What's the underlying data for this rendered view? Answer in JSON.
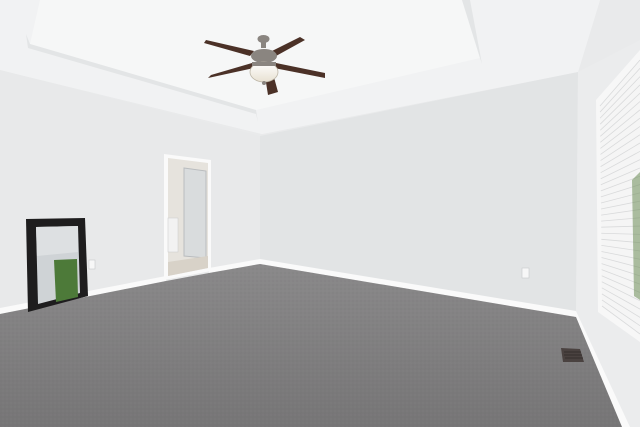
{
  "colors": {
    "ceiling": "#f1f2f3",
    "tray_ceiling": "#f6f7f7",
    "tray_side": "#e3e5e6",
    "left_wall": "#e8e9ea",
    "back_wall": "#e2e4e5",
    "right_wall": "#ebeced",
    "baseboard": "#fafafa",
    "carpet": "#7c7b7c",
    "carpet_dark": "#6e6d6e",
    "fan_blade": "#4b3127",
    "fan_metal": "#8a8580",
    "fan_light": "#f3efe6",
    "mirror_frame": "#1e1d1e",
    "mirror_glass": "#cfd3d6",
    "mirror_greenery": "#4d7a39",
    "blinds": "#f5f5f5",
    "doorway": "#e6e3dd",
    "vent": "#4a4240"
  },
  "objects": [
    "ceiling-fan",
    "tray-ceiling",
    "floor-mirror",
    "doorway",
    "window-blinds",
    "floor-vent",
    "wall-outlet"
  ]
}
